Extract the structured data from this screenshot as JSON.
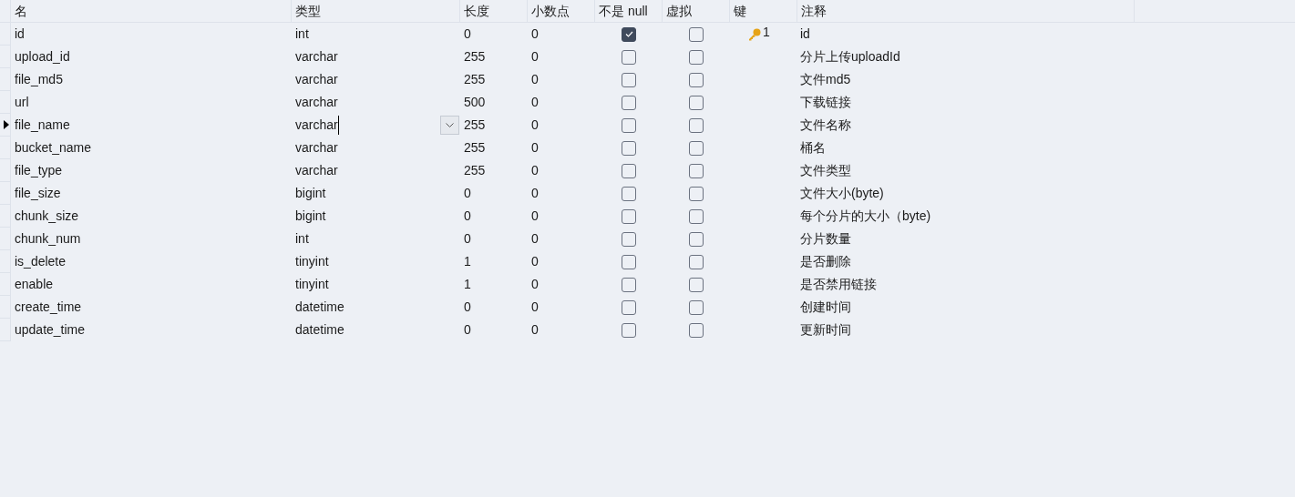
{
  "columns": [
    "名",
    "类型",
    "长度",
    "小数点",
    "不是 null",
    "虚拟",
    "键",
    "注释"
  ],
  "rows": [
    {
      "name": "id",
      "type": "int",
      "length": "0",
      "decimals": "0",
      "not_null": true,
      "virtual": false,
      "key": "1",
      "comment": "id",
      "current": false
    },
    {
      "name": "upload_id",
      "type": "varchar",
      "length": "255",
      "decimals": "0",
      "not_null": false,
      "virtual": false,
      "comment": "分片上传uploadId",
      "current": false
    },
    {
      "name": "file_md5",
      "type": "varchar",
      "length": "255",
      "decimals": "0",
      "not_null": false,
      "virtual": false,
      "comment": "文件md5",
      "current": false
    },
    {
      "name": "url",
      "type": "varchar",
      "length": "500",
      "decimals": "0",
      "not_null": false,
      "virtual": false,
      "comment": "下载链接",
      "current": false
    },
    {
      "name": "file_name",
      "type": "varchar",
      "length": "255",
      "decimals": "0",
      "not_null": false,
      "virtual": false,
      "comment": "文件名称",
      "current": true
    },
    {
      "name": "bucket_name",
      "type": "varchar",
      "length": "255",
      "decimals": "0",
      "not_null": false,
      "virtual": false,
      "comment": "桶名",
      "current": false
    },
    {
      "name": "file_type",
      "type": "varchar",
      "length": "255",
      "decimals": "0",
      "not_null": false,
      "virtual": false,
      "comment": "文件类型",
      "current": false
    },
    {
      "name": "file_size",
      "type": "bigint",
      "length": "0",
      "decimals": "0",
      "not_null": false,
      "virtual": false,
      "comment": "文件大小(byte)",
      "current": false
    },
    {
      "name": "chunk_size",
      "type": "bigint",
      "length": "0",
      "decimals": "0",
      "not_null": false,
      "virtual": false,
      "comment": "每个分片的大小（byte)",
      "current": false
    },
    {
      "name": "chunk_num",
      "type": "int",
      "length": "0",
      "decimals": "0",
      "not_null": false,
      "virtual": false,
      "comment": "分片数量",
      "current": false
    },
    {
      "name": "is_delete",
      "type": "tinyint",
      "length": "1",
      "decimals": "0",
      "not_null": false,
      "virtual": false,
      "comment": "是否删除",
      "current": false
    },
    {
      "name": "enable",
      "type": "tinyint",
      "length": "1",
      "decimals": "0",
      "not_null": false,
      "virtual": false,
      "comment": "是否禁用链接",
      "current": false
    },
    {
      "name": "create_time",
      "type": "datetime",
      "length": "0",
      "decimals": "0",
      "not_null": false,
      "virtual": false,
      "comment": "创建时间",
      "current": false
    },
    {
      "name": "update_time",
      "type": "datetime",
      "length": "0",
      "decimals": "0",
      "not_null": false,
      "virtual": false,
      "comment": "更新时间",
      "current": false
    }
  ]
}
